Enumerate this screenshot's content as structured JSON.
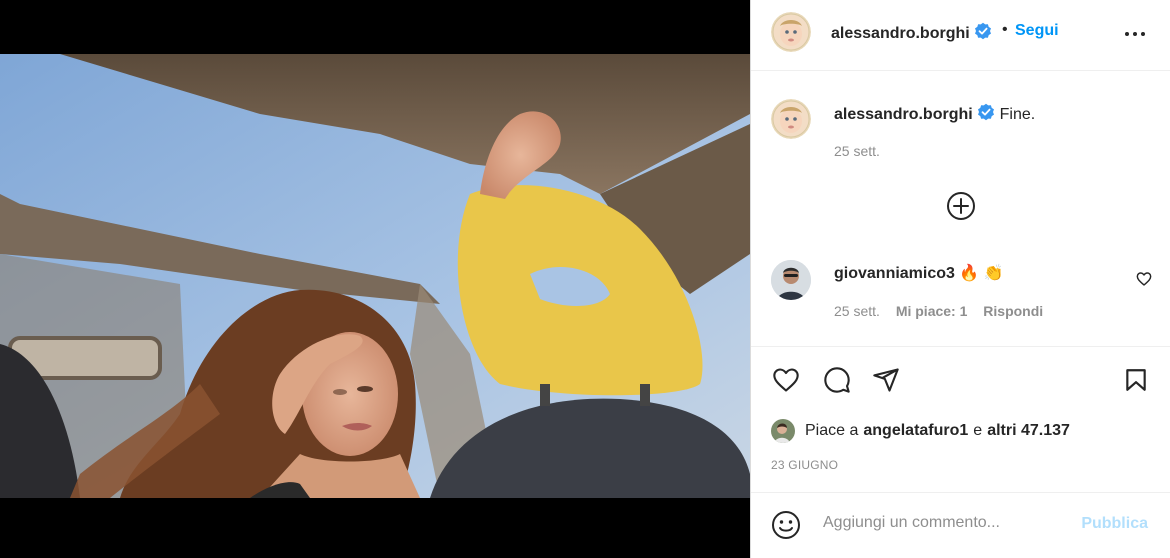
{
  "post": {
    "photo_alt": "Woman with windswept hair in a car with open roof and yellow headrest"
  },
  "header": {
    "username": "alessandro.borghi",
    "follow_label": "Segui",
    "more_icon": "more-horizontal-icon"
  },
  "caption": {
    "username": "alessandro.borghi",
    "text": "Fine.",
    "time": "25 sett."
  },
  "load_more_icon": "plus-circle-icon",
  "comments": [
    {
      "username": "giovanniamico3",
      "text": "🔥 👏",
      "time": "25 sett.",
      "likes_label": "Mi piace: 1",
      "reply_label": "Rispondi"
    }
  ],
  "likes": {
    "prefix": "Piace a",
    "user": "angelatafuro1",
    "and": "e",
    "others": "altri 47.137"
  },
  "post_date": "23 GIUGNO",
  "add_comment": {
    "placeholder": "Aggiungi un commento...",
    "publish_label": "Pubblica"
  },
  "colors": {
    "accent": "#0095f6",
    "accent_disabled": "#b2dffc",
    "verified": "#3897f0",
    "text": "#262626",
    "muted": "#8e8e8e"
  }
}
